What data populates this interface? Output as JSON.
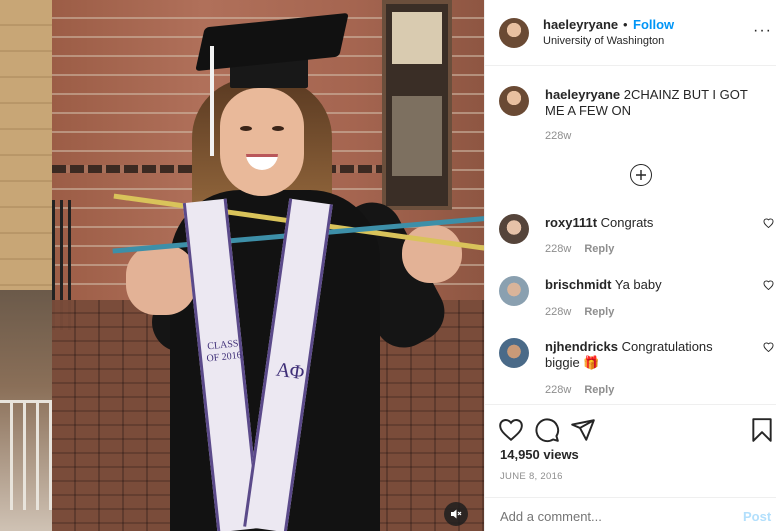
{
  "post": {
    "username": "haeleyryane",
    "follow_label": "Follow",
    "separator": "•",
    "location": "University of Washington",
    "more_label": "···"
  },
  "photo": {
    "stole_left_text": "CLASS OF 2016",
    "stole_right_text": "ΑΦ"
  },
  "caption": {
    "username": "haeleyryane",
    "text": "2CHAINZ BUT I GOT ME A FEW ON",
    "time": "228w"
  },
  "comments": [
    {
      "username": "roxy111t",
      "text": "Congrats",
      "time": "228w",
      "reply_label": "Reply"
    },
    {
      "username": "brischmidt",
      "text": "Ya baby",
      "time": "228w",
      "reply_label": "Reply"
    },
    {
      "username": "njhendricks",
      "text": "Congratulations biggie 🎁",
      "time": "228w",
      "reply_label": "Reply"
    }
  ],
  "stats": {
    "views": "14,950 views",
    "date": "JUNE 8, 2016"
  },
  "composer": {
    "placeholder": "Add a comment...",
    "post_label": "Post"
  },
  "icons": {
    "like": "heart-icon",
    "comment": "comment-icon",
    "share": "paper-plane-icon",
    "save": "bookmark-icon",
    "load_more": "plus-circle-icon",
    "mute": "speaker-muted-icon"
  },
  "colors": {
    "accent": "#0095f6",
    "post_disabled": "#b2dffc",
    "muted_text": "#8e8e8e"
  }
}
